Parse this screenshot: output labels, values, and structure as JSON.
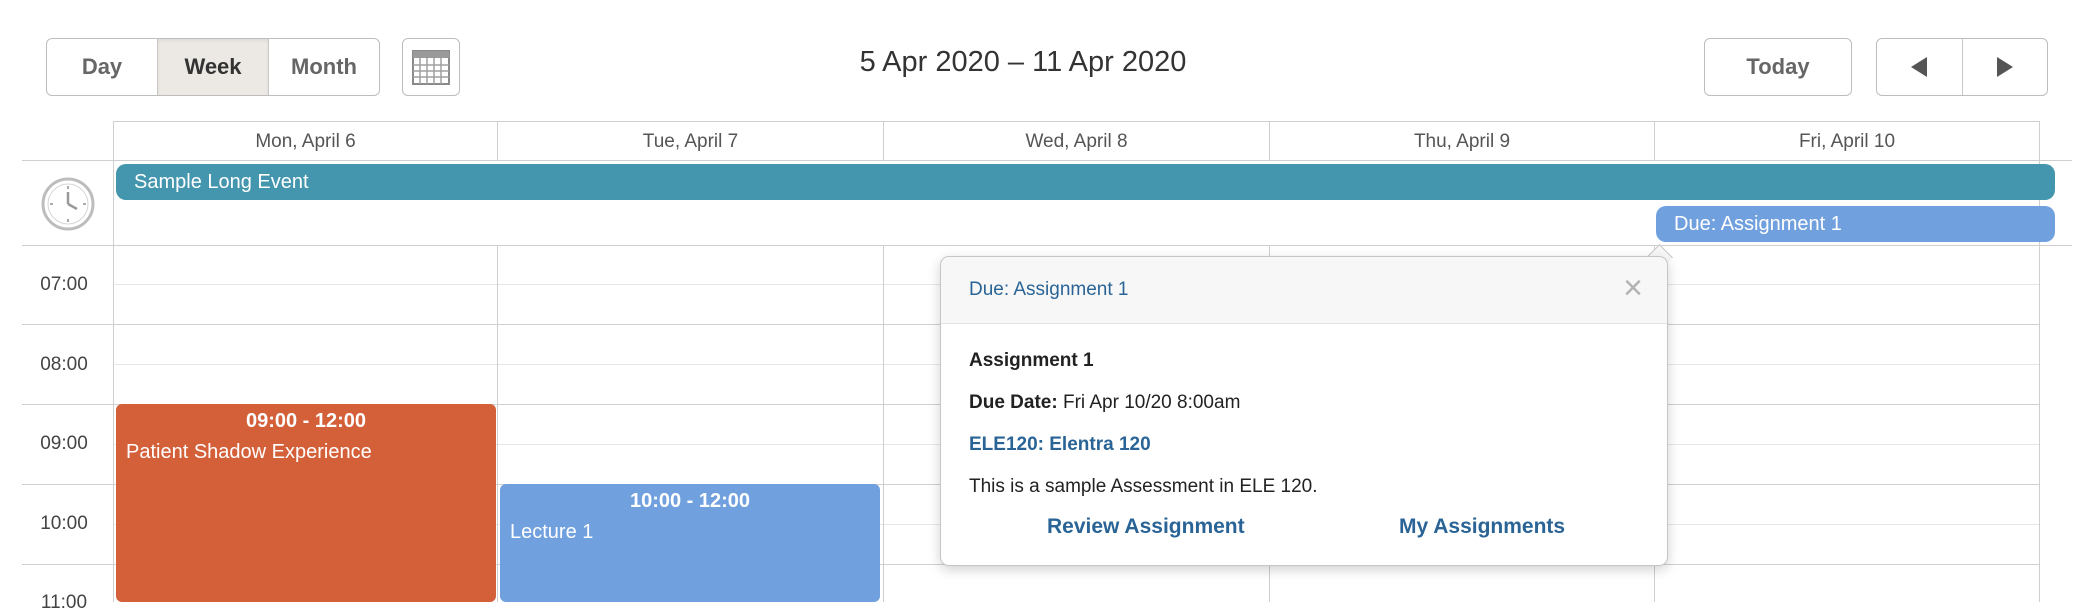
{
  "toolbar": {
    "views": [
      {
        "label": "Day",
        "active": false
      },
      {
        "label": "Week",
        "active": true
      },
      {
        "label": "Month",
        "active": false
      }
    ],
    "range_title": "5 Apr 2020 – 11 Apr 2020",
    "today_label": "Today",
    "prev_icon": "triangle-left-icon",
    "next_icon": "triangle-right-icon",
    "calendar_icon": "calendar-grid-icon"
  },
  "days": [
    {
      "label": "Mon, April 6"
    },
    {
      "label": "Tue, April 7"
    },
    {
      "label": "Wed, April 8"
    },
    {
      "label": "Thu, April 9"
    },
    {
      "label": "Fri, April 10"
    }
  ],
  "allday": {
    "icon": "clock-icon",
    "events": [
      {
        "title": "Sample Long Event",
        "color": "#4396ad"
      },
      {
        "title": "Due: Assignment 1",
        "color": "#71a0df"
      }
    ]
  },
  "times": [
    "07:00",
    "08:00",
    "09:00",
    "10:00",
    "11:00"
  ],
  "events": [
    {
      "time": "09:00 - 12:00",
      "title": "Patient Shadow Experience",
      "color": "#d4603a"
    },
    {
      "time": "10:00 - 12:00",
      "title": "Lecture 1",
      "color": "#71a0df"
    }
  ],
  "popover": {
    "title": "Due: Assignment 1",
    "close": "×",
    "assignment_name": "Assignment 1",
    "due_label": "Due Date:",
    "due_value": "Fri Apr 10/20 8:00am",
    "course_link": "ELE120: Elentra 120",
    "description": "This is a sample Assessment in ELE 120.",
    "review_label": "Review Assignment",
    "my_assignments_label": "My Assignments"
  }
}
